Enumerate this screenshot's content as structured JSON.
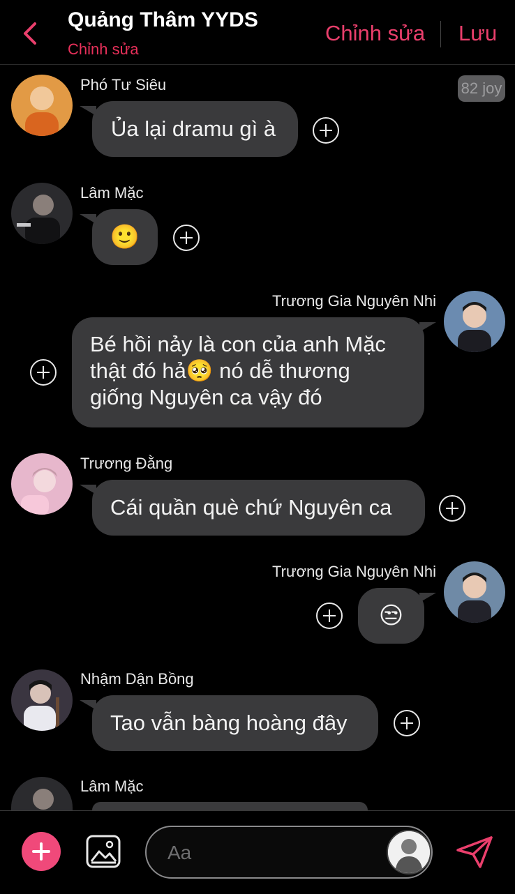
{
  "header": {
    "title": "Quảng Thâm YYDS",
    "subtitle": "Chỉnh sửa",
    "edit_label": "Chỉnh sửa",
    "save_label": "Lưu",
    "accent_color": "#ea3f6c"
  },
  "joy_badge": "82 joy",
  "messages": [
    {
      "sender": "Phó Tư Siêu",
      "text": "Ủa lại dramu gì à",
      "side": "left"
    },
    {
      "sender": "Lâm Mặc",
      "text": "🙂",
      "side": "left"
    },
    {
      "sender": "Trương Gia Nguyên Nhi",
      "lines": [
        "Bé hồi nảy là con của anh Mặc",
        "thật đó hả🥺 nó dễ thương",
        "giống Nguyên ca vậy đó"
      ],
      "side": "right"
    },
    {
      "sender": "Trương Đằng",
      "text": "Cái quần què chứ Nguyên ca",
      "side": "left"
    },
    {
      "sender": "Trương Gia Nguyên Nhi",
      "text": "😒",
      "side": "right"
    },
    {
      "sender": "Nhậm Dận Bồng",
      "text": "Tao vẫn bàng hoàng đây",
      "side": "left"
    },
    {
      "sender": "Lâm Mặc",
      "text": "",
      "side": "left"
    }
  ],
  "composer": {
    "placeholder": "Aa",
    "icons": [
      "plus-icon",
      "image-icon",
      "user-avatar-icon",
      "send-icon"
    ]
  }
}
